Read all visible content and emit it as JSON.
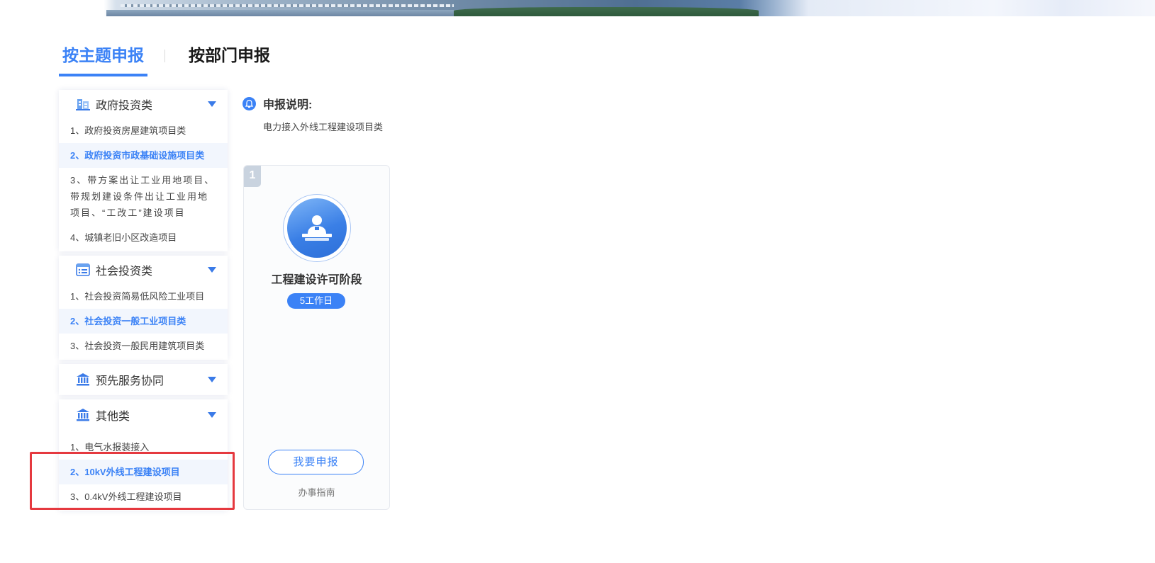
{
  "tabs": [
    {
      "label": "按主题申报",
      "active": true
    },
    {
      "label": "按部门申报",
      "active": false
    }
  ],
  "sidebar": {
    "groups": [
      {
        "title": "政府投资类",
        "icon": "building-icon",
        "items": [
          {
            "label": "1、政府投资房屋建筑项目类",
            "active": false
          },
          {
            "label": "2、政府投资市政基础设施项目类",
            "active": true
          },
          {
            "label": "3、带方案出让工业用地项目、带规划建设条件出让工业用地项目、“工改工”建设项目",
            "active": false
          },
          {
            "label": "4、城镇老旧小区改造项目",
            "active": false
          }
        ]
      },
      {
        "title": "社会投资类",
        "icon": "list-icon",
        "items": [
          {
            "label": "1、社会投资简易低风险工业项目",
            "active": false
          },
          {
            "label": "2、社会投资一般工业项目类",
            "active": true
          },
          {
            "label": "3、社会投资一般民用建筑项目类",
            "active": false
          }
        ]
      },
      {
        "title": "预先服务协同",
        "icon": "bank-icon",
        "items": []
      },
      {
        "title": "其他类",
        "icon": "bank-icon",
        "items": [
          {
            "label": "1、电气水报装接入",
            "active": false
          },
          {
            "label": "2、10kV外线工程建设项目",
            "active": true
          },
          {
            "label": "3、0.4kV外线工程建设项目",
            "active": false
          }
        ]
      }
    ]
  },
  "description": {
    "title": "申报说明:",
    "text": "电力接入外线工程建设项目类"
  },
  "card": {
    "number": "1",
    "stage": "工程建设许可阶段",
    "days": "5工作日",
    "apply_label": "我要申报",
    "guide_label": "办事指南"
  },
  "colors": {
    "accent": "#3b82f6",
    "highlight": "#e5393f"
  }
}
